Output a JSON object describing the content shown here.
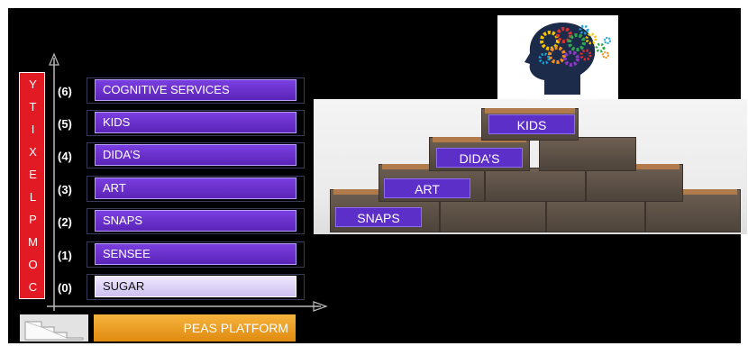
{
  "axis": {
    "label_letters": [
      "C",
      "O",
      "M",
      "P",
      "L",
      "E",
      "X",
      "I",
      "T",
      "Y"
    ]
  },
  "levels": [
    {
      "num": "(6)",
      "label": "COGNITIVE SERVICES"
    },
    {
      "num": "(5)",
      "label": "KIDS"
    },
    {
      "num": "(4)",
      "label": "DIDA’S"
    },
    {
      "num": "(3)",
      "label": "ART"
    },
    {
      "num": "(2)",
      "label": "SNAPS"
    },
    {
      "num": "(1)",
      "label": "SENSEE"
    },
    {
      "num": "(0)",
      "label": "SUGAR"
    }
  ],
  "platform_label": "PEAS PLATFORM",
  "photo_labels": {
    "kids": "KIDS",
    "didas": "DIDA’S",
    "art": "ART",
    "snaps": "SNAPS"
  },
  "colors": {
    "background": "#000000",
    "complexity": "#e21a24",
    "level_bar": "#6a32d0",
    "base_bar": "#e0d4ff",
    "platform": "#f0a020"
  }
}
